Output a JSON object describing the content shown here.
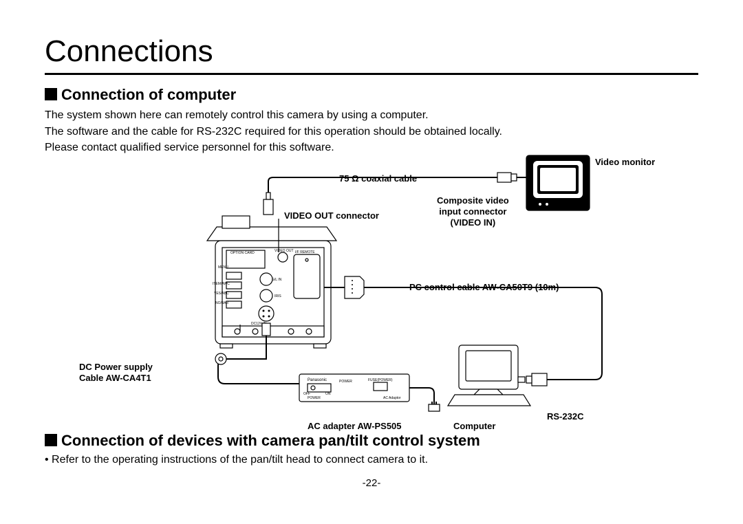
{
  "title": "Connections",
  "section1": {
    "heading": "Connection of computer",
    "p1": "The system shown here can remotely control this camera by using a computer.",
    "p2": "The software and the cable for RS-232C required for this operation should be obtained locally.",
    "p3": "Please contact qualified service personnel for this software."
  },
  "diagram": {
    "coaxial": "75 Ω coaxial cable",
    "video_out": "VIDEO OUT connector",
    "video_monitor": "Video monitor",
    "composite": "Composite video",
    "composite2": "input connector",
    "composite3": "(VIDEO IN)",
    "pc_cable": "PC control cable AW-CA50T9 (10m)",
    "dc_power1": "DC Power supply",
    "dc_power2": "Cable AW-CA4T1",
    "ac_adapter": "AC adapter AW-PS505",
    "computer": "Computer",
    "rs232c": "RS-232C",
    "camera_labels": {
      "option_card": "OPTION CARD",
      "video_out_port": "VIDEO OUT",
      "if_remote": "I/F REMOTE",
      "menu": "MENU",
      "gl_in": "G/L IN",
      "item_awc": "ITEM/AWC",
      "yes_abc": "YES/ABC",
      "iris": "IRIS",
      "no_bar": "NO/BAR",
      "dc12v_in": "DC12V IN"
    },
    "ac_labels": {
      "brand": "Panasonic",
      "power": "POWER",
      "fuse": "FUSE(POWER)",
      "off": "OFF",
      "on": "ON",
      "ac_adapter_text": "AC Adaptor"
    }
  },
  "section2": {
    "heading": "Connection of devices with camera pan/tilt control system",
    "bullet": "• Refer to the operating instructions of the pan/tilt head to connect camera to it."
  },
  "page_number": "-22-"
}
